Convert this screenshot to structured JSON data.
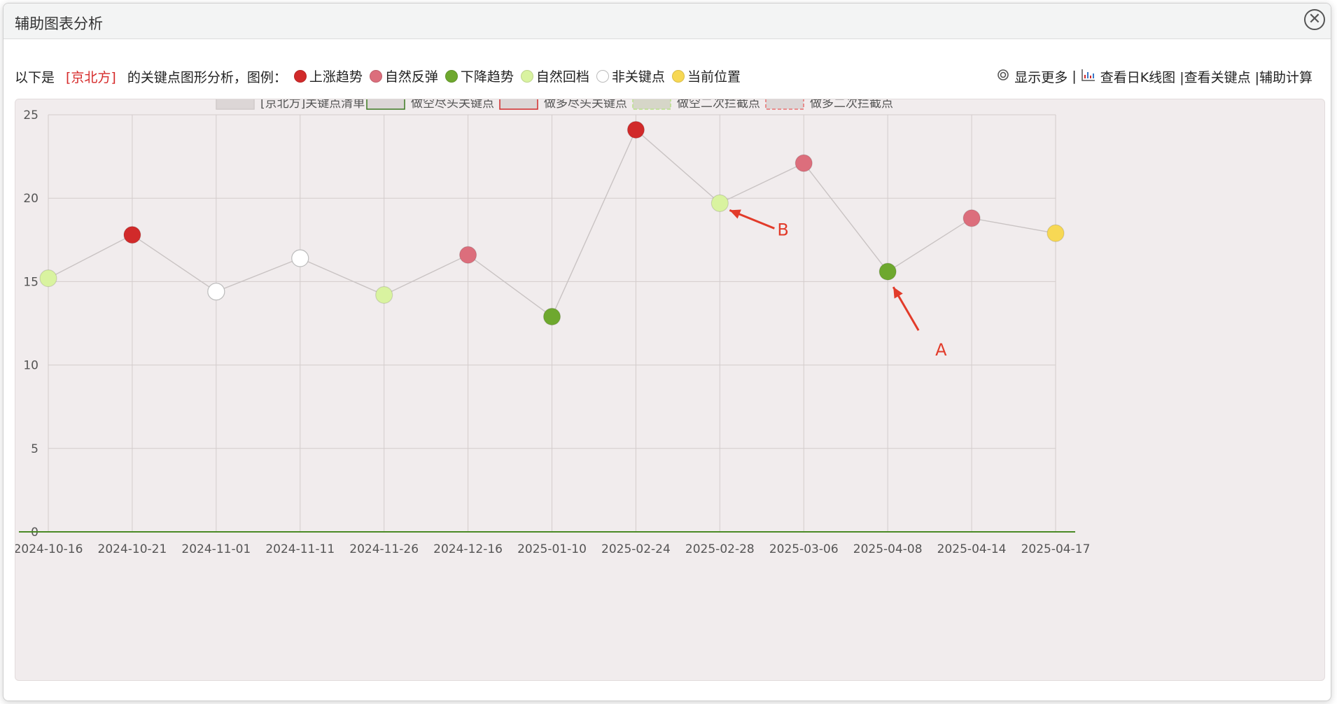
{
  "dialog": {
    "title": "辅助图表分析",
    "close_icon": "close-icon"
  },
  "info": {
    "prefix": "以下是",
    "stock": "[京北方]",
    "suffix": "的关键点图形分析，图例：",
    "legend": [
      {
        "label": "上涨趋势",
        "color": "#d12a2a"
      },
      {
        "label": "自然反弹",
        "color": "#dc6e7c"
      },
      {
        "label": "下降趋势",
        "color": "#6ea82e"
      },
      {
        "label": "自然回档",
        "color": "#d9f3a0"
      },
      {
        "label": "非关键点",
        "color": "#ffffff"
      },
      {
        "label": "当前位置",
        "color": "#f7d854"
      }
    ]
  },
  "links": {
    "show_more": "显示更多",
    "sep": "|",
    "kline": "查看日K线图",
    "keypoints": "|查看关键点",
    "calc": "|辅助计算"
  },
  "chart_data": {
    "type": "line",
    "legend": [
      {
        "label": "[京北方]关键点清单",
        "style": "plain"
      },
      {
        "label": "做空尽头关键点",
        "style": "green-border"
      },
      {
        "label": "做多尽头关键点",
        "style": "red-border"
      },
      {
        "label": "做空二次拦截点",
        "style": "green-dashed"
      },
      {
        "label": "做多二次拦截点",
        "style": "red-dashed"
      }
    ],
    "categories": [
      "2024-10-16",
      "2024-10-21",
      "2024-11-01",
      "2024-11-11",
      "2024-11-26",
      "2024-12-16",
      "2025-01-10",
      "2025-02-24",
      "2025-02-28",
      "2025-03-06",
      "2025-04-08",
      "2025-04-14",
      "2025-04-17"
    ],
    "values": [
      15.2,
      17.8,
      14.4,
      16.4,
      14.2,
      16.6,
      12.9,
      24.1,
      19.7,
      22.1,
      15.6,
      18.8,
      17.9
    ],
    "point_types": [
      "自然回档",
      "上涨趋势",
      "非关键点",
      "非关键点",
      "自然回档",
      "自然反弹",
      "下降趋势",
      "上涨趋势",
      "自然回档",
      "自然反弹",
      "下降趋势",
      "自然反弹",
      "当前位置"
    ],
    "yticks": [
      0,
      5,
      10,
      15,
      20,
      25
    ],
    "ylim": [
      0,
      25
    ],
    "grid": true,
    "annotations": [
      {
        "label": "A",
        "point_index": 10,
        "color": "#e23b2a"
      },
      {
        "label": "B",
        "point_index": 8,
        "color": "#e23b2a"
      }
    ]
  }
}
